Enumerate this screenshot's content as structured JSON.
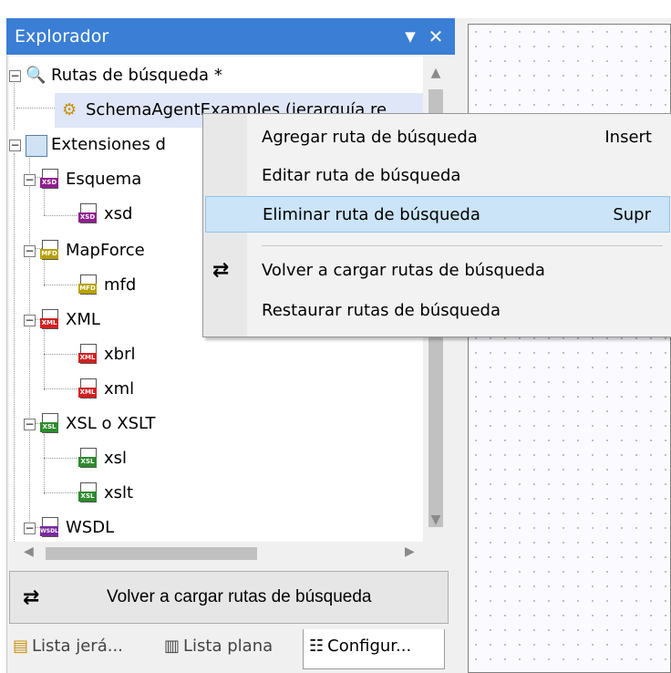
{
  "panel": {
    "title": "Explorador",
    "pin_icon": "dropdown-arrow-icon",
    "close_icon": "close-icon"
  },
  "tree": {
    "search_paths": "Rutas de búsqueda *",
    "schema_agent": "SchemaAgentExamples (jerarquía re",
    "extensions": "Extensiones d",
    "esquema": "Esquema",
    "xsd": "xsd",
    "mapforce": "MapForce",
    "mfd": "mfd",
    "xml": "XML",
    "xbrl": "xbrl",
    "xml_leaf": "xml",
    "xsl_group": "XSL o XSLT",
    "xsl": "xsl",
    "xslt": "xslt",
    "wsdl": "WSDL",
    "tags": {
      "xsd": "XSD",
      "mfd": "MFD",
      "xml": "XML",
      "xsl": "XSL",
      "wsdl": "WSDL"
    },
    "colors": {
      "xsd": "#8e1e8e",
      "mfd": "#b8a200",
      "xml": "#d32020",
      "xsl": "#2e8b2e",
      "wsdl": "#7a2aa0"
    }
  },
  "context_menu": {
    "items": [
      {
        "label": "Agregar ruta de búsqueda",
        "shortcut": "Insert"
      },
      {
        "label": "Editar ruta de búsqueda",
        "shortcut": ""
      },
      {
        "label": "Eliminar ruta de búsqueda",
        "shortcut": "Supr"
      },
      {
        "label": "Volver a cargar rutas de búsqueda",
        "shortcut": ""
      },
      {
        "label": "Restaurar rutas de búsqueda",
        "shortcut": ""
      }
    ]
  },
  "reload_button": {
    "label": "Volver a cargar rutas de búsqueda"
  },
  "tabs": [
    {
      "label": "Lista jerá..."
    },
    {
      "label": "Lista plana"
    },
    {
      "label": "Configur..."
    }
  ],
  "theme": {
    "titlebar": "#3a7fd5",
    "highlight": "#cce4f7"
  }
}
